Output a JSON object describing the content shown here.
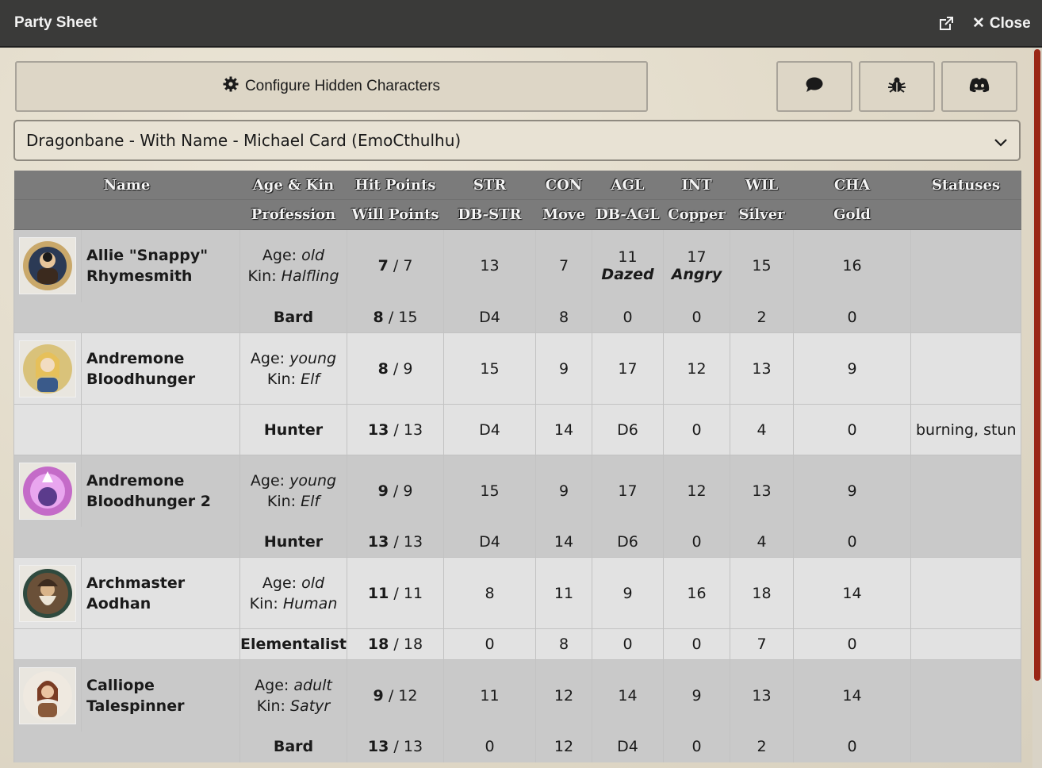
{
  "window": {
    "title": "Party Sheet",
    "close_label": "Close"
  },
  "toolbar": {
    "configure_label": "Configure Hidden Characters",
    "icons": [
      "comment-icon",
      "bug-icon",
      "discord-icon"
    ]
  },
  "template_select": {
    "value": "Dragonbane - With Name - Michael Card (EmoCthulhu)"
  },
  "columns": {
    "row1": [
      "Name",
      "Age & Kin",
      "Hit Points",
      "STR",
      "CON",
      "AGL",
      "INT",
      "WIL",
      "CHA",
      "Statuses"
    ],
    "row2": [
      "",
      "Profession",
      "Will Points",
      "DB-STR",
      "Move",
      "DB-AGL",
      "Copper",
      "Silver",
      "Gold",
      ""
    ]
  },
  "characters": [
    {
      "name": "Allie \"Snappy\" Rhymesmith",
      "age": "old",
      "kin": "Halfling",
      "hp_cur": "7",
      "hp_max": "7",
      "str": "13",
      "con": "7",
      "agl": "11",
      "agl_cond": "Dazed",
      "int": "17",
      "int_cond": "Angry",
      "wil": "15",
      "cha": "16",
      "profession": "Bard",
      "wp_cur": "8",
      "wp_max": "15",
      "db_str": "D4",
      "move": "8",
      "db_agl": "0",
      "copper": "0",
      "silver": "2",
      "gold": "0",
      "statuses": ""
    },
    {
      "name": "Andremone Bloodhunger",
      "age": "young",
      "kin": "Elf",
      "hp_cur": "8",
      "hp_max": "9",
      "str": "15",
      "con": "9",
      "agl": "17",
      "agl_cond": "",
      "int": "12",
      "int_cond": "",
      "wil": "13",
      "cha": "9",
      "profession": "Hunter",
      "wp_cur": "13",
      "wp_max": "13",
      "db_str": "D4",
      "move": "14",
      "db_agl": "D6",
      "copper": "0",
      "silver": "4",
      "gold": "0",
      "statuses": "burning, stun"
    },
    {
      "name": "Andremone Bloodhunger 2",
      "age": "young",
      "kin": "Elf",
      "hp_cur": "9",
      "hp_max": "9",
      "str": "15",
      "con": "9",
      "agl": "17",
      "agl_cond": "",
      "int": "12",
      "int_cond": "",
      "wil": "13",
      "cha": "9",
      "profession": "Hunter",
      "wp_cur": "13",
      "wp_max": "13",
      "db_str": "D4",
      "move": "14",
      "db_agl": "D6",
      "copper": "0",
      "silver": "4",
      "gold": "0",
      "statuses": ""
    },
    {
      "name": "Archmaster Aodhan",
      "age": "old",
      "kin": "Human",
      "hp_cur": "11",
      "hp_max": "11",
      "str": "8",
      "con": "11",
      "agl": "9",
      "agl_cond": "",
      "int": "16",
      "int_cond": "",
      "wil": "18",
      "cha": "14",
      "profession": "Elementalist",
      "wp_cur": "18",
      "wp_max": "18",
      "db_str": "0",
      "move": "8",
      "db_agl": "0",
      "copper": "0",
      "silver": "7",
      "gold": "0",
      "statuses": ""
    },
    {
      "name": "Calliope Talespinner",
      "age": "adult",
      "kin": "Satyr",
      "hp_cur": "9",
      "hp_max": "12",
      "str": "11",
      "con": "12",
      "agl": "14",
      "agl_cond": "",
      "int": "9",
      "int_cond": "",
      "wil": "13",
      "cha": "14",
      "profession": "Bard",
      "wp_cur": "13",
      "wp_max": "13",
      "db_str": "0",
      "move": "12",
      "db_agl": "D4",
      "copper": "0",
      "silver": "2",
      "gold": "0",
      "statuses": ""
    }
  ],
  "labels": {
    "age_prefix": "Age:",
    "kin_prefix": "Kin:",
    "slash": "/"
  },
  "colors": {
    "titlebar": "#3a3a39",
    "header": "#7b7b7b",
    "scroll_thumb": "#9a2616"
  }
}
